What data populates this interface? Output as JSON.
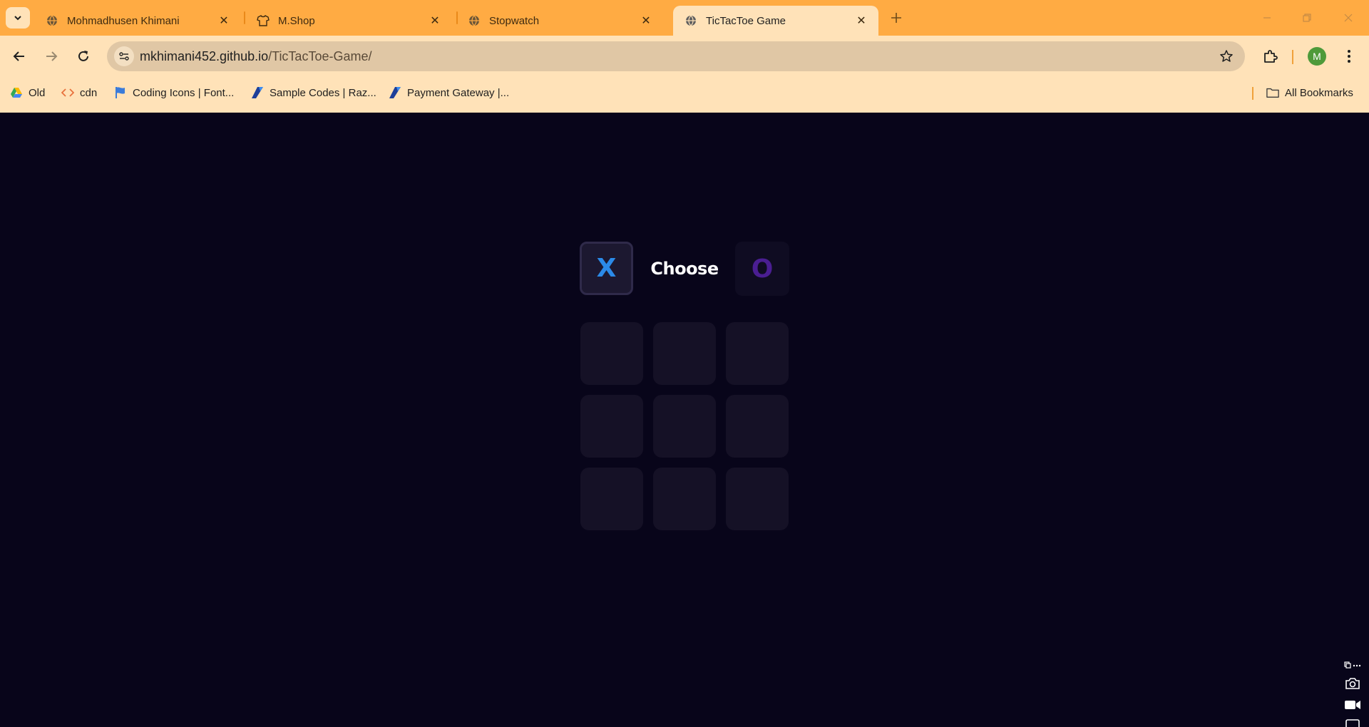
{
  "browser": {
    "tabs": [
      {
        "title": "Mohmadhusen Khimani",
        "favicon": "globe-icon",
        "active": false
      },
      {
        "title": "M.Shop",
        "favicon": "shirt-icon",
        "active": false
      },
      {
        "title": "Stopwatch",
        "favicon": "globe-icon",
        "active": false
      },
      {
        "title": "TicTacToe Game",
        "favicon": "globe-icon",
        "active": true
      }
    ],
    "address": {
      "host": "mkhimani452.github.io",
      "path": "/TicTacToe-Game/"
    },
    "profile_initial": "M",
    "bookmarks": [
      {
        "label": "Old",
        "icon": "drive-icon"
      },
      {
        "label": "cdn",
        "icon": "code-icon"
      },
      {
        "label": "Coding Icons | Font...",
        "icon": "flag-icon"
      },
      {
        "label": "Sample Codes | Raz...",
        "icon": "razorpay-icon"
      },
      {
        "label": "Payment Gateway |...",
        "icon": "razorpay-icon"
      }
    ],
    "all_bookmarks_label": "All Bookmarks",
    "colors": {
      "titlebar": "#ffab43",
      "toolbar": "#ffe2b8"
    }
  },
  "game": {
    "choose_label": "Choose",
    "option_x": "X",
    "option_o": "O",
    "selected": "X",
    "board": [
      "",
      "",
      "",
      "",
      "",
      "",
      "",
      "",
      ""
    ],
    "colors": {
      "background": "#08051a",
      "x": "#2b8ae8",
      "o": "#4a1e92",
      "cell": "#151126"
    }
  }
}
